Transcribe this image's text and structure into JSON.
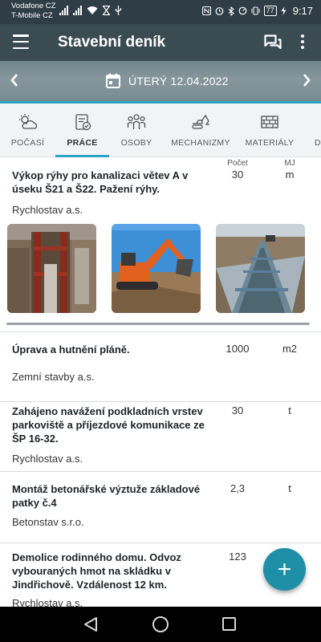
{
  "status_bar": {
    "carrier1": "Vodafone CZ",
    "carrier2": "T-Mobile CZ",
    "battery": "77",
    "time": "9:17"
  },
  "app_bar": {
    "title": "Stavební deník",
    "menu_icon": "hamburger-icon",
    "chat_icon": "chat-icon",
    "more_icon": "more-vert-icon"
  },
  "date_bar": {
    "date": "ÚTERÝ 12.04.2022",
    "prev_icon": "chevron-left-icon",
    "next_icon": "chevron-right-icon",
    "calendar_icon": "calendar-icon"
  },
  "tabs": [
    {
      "label": "POČASÍ",
      "icon": "weather-icon",
      "active": false
    },
    {
      "label": "PRÁCE",
      "icon": "work-icon",
      "active": true
    },
    {
      "label": "OSOBY",
      "icon": "people-icon",
      "active": false
    },
    {
      "label": "MECHANIZMY",
      "icon": "machinery-icon",
      "active": false
    },
    {
      "label": "MATERIÁLY",
      "icon": "materials-icon",
      "active": false
    },
    {
      "label": "D",
      "icon": "more-tab-icon",
      "active": false
    }
  ],
  "columns": {
    "qty": "Počet",
    "unit": "MJ"
  },
  "entries": [
    {
      "title": "Výkop rýhy pro kanalizaci větev A v úseku Š21 a Š22. Pažení rýhy.",
      "qty": "30",
      "unit": "m",
      "company": "Rychlostav a.s.",
      "photos": [
        "trench-shoring-photo",
        "excavator-photo",
        "trench-panorama-photo"
      ]
    },
    {
      "title": "Úprava a hutnění pláně.",
      "qty": "1000",
      "unit": "m2",
      "company": "Zemní stavby a.s."
    },
    {
      "title": "Zahájeno navážení podkladních vrstev parkoviště a příjezdové komunikace ze ŠP 16-32.",
      "qty": "30",
      "unit": "t",
      "company": "Rychlostav a.s."
    },
    {
      "title": "Montáž betonářské výztuže základové patky č.4",
      "qty": "2,3",
      "unit": "t",
      "company": "Betonstav s.r.o."
    },
    {
      "title": "Demolice rodinného domu. Odvoz vybouraných hmot na skládku v Jindřichově. Vzdálenost 12 km.",
      "qty": "123",
      "unit": "",
      "company": "Rychlostav a.s."
    }
  ],
  "fab": {
    "label": "+"
  },
  "colors": {
    "app_bar": "#3b4b52",
    "accent": "#2aa6c4",
    "fab": "#1f8fa8"
  }
}
